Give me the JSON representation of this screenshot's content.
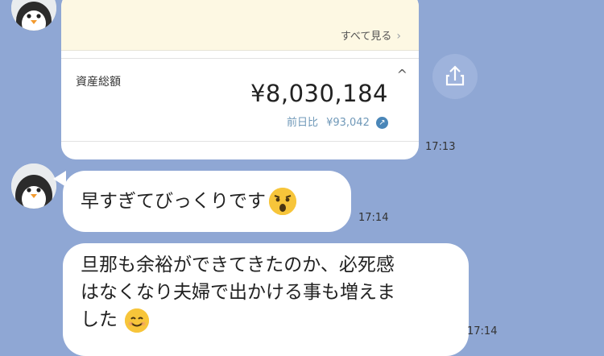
{
  "card": {
    "see_all": "すべて見る",
    "chevron": "›",
    "asset_label": "資産総額",
    "asset_value": "¥8,030,184",
    "change_label": "前日比",
    "change_value": "¥93,042",
    "caret": "^",
    "time": "17:13"
  },
  "messages": [
    {
      "text": "早すぎてびっくりです",
      "emoji": "astonished-face-emoji",
      "time": "17:14"
    },
    {
      "line1": "旦那も余裕ができてきたのか、必死感",
      "line2": "はなくなり夫婦で出かける事も増えま",
      "line3": "した",
      "emoji": "smiling-face-emoji",
      "time": "17:14"
    }
  ],
  "colors": {
    "background": "#8fa7d4",
    "bubble": "#ffffff",
    "change_text": "#6f98b8"
  }
}
